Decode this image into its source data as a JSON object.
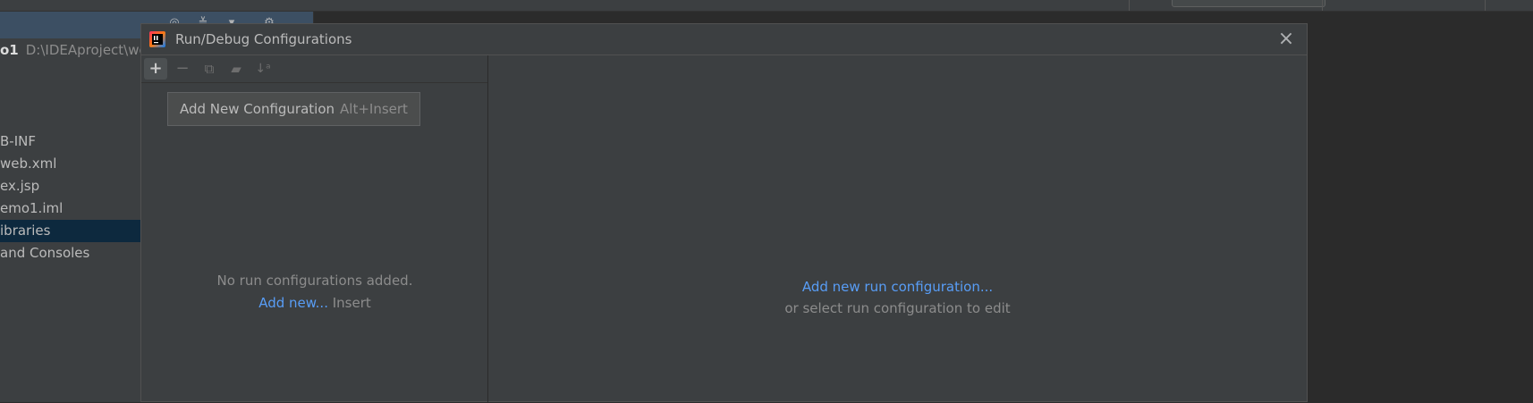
{
  "project_panel": {
    "header_name": "o1",
    "header_path": "D:\\IDEAproject\\we",
    "tree_items": [
      {
        "label": "B-INF",
        "selected": false
      },
      {
        "label": "web.xml",
        "selected": false
      },
      {
        "label": "ex.jsp",
        "selected": false
      },
      {
        "label": "emo1.iml",
        "selected": false
      },
      {
        "label": "ibraries",
        "selected": true
      },
      {
        "label": " and Consoles",
        "selected": false
      }
    ]
  },
  "dialog": {
    "title": "Run/Debug Configurations",
    "close_icon": "close-icon",
    "toolbar": {
      "add": "plus-icon",
      "remove": "minus-icon",
      "copy": "copy-icon",
      "folder": "new-folder-icon",
      "sort": "sort-alpha-icon"
    },
    "tooltip": {
      "label": "Add New Configuration",
      "shortcut": "Alt+Insert"
    },
    "left_empty": {
      "message": "No run configurations added.",
      "link": "Add new...",
      "shortcut": "Insert"
    },
    "right_empty": {
      "link": "Add new run configuration...",
      "hint": "or select run configuration to edit"
    }
  },
  "colors": {
    "dialog_bg": "#3c3f41",
    "link": "#589df6",
    "selection": "#0d293e",
    "muted_text": "#8c8c8c"
  }
}
